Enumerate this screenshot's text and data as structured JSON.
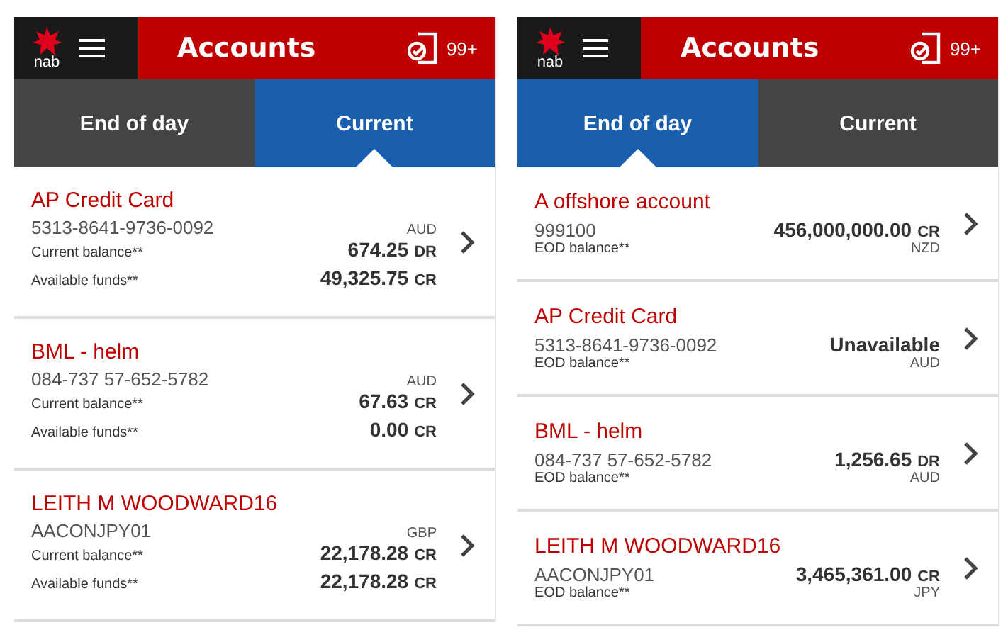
{
  "screens": [
    {
      "header": {
        "logo_text": "nab",
        "title": "Accounts",
        "badge": "99+"
      },
      "tabs": [
        {
          "label": "End of day",
          "selected": false
        },
        {
          "label": "Current",
          "selected": true
        }
      ],
      "accounts": [
        {
          "kind": "current",
          "name": "AP Credit Card",
          "number": "5313-8641-9736-0092",
          "currency": "AUD",
          "lines": [
            {
              "label": "Current balance**",
              "amount": "674.25",
              "type": "DR"
            },
            {
              "label": "Available funds**",
              "amount": "49,325.75",
              "type": "CR"
            }
          ]
        },
        {
          "kind": "current",
          "name": "BML - helm",
          "number": "084-737 57-652-5782",
          "currency": "AUD",
          "lines": [
            {
              "label": "Current balance**",
              "amount": "67.63",
              "type": "CR"
            },
            {
              "label": "Available funds**",
              "amount": "0.00",
              "type": "CR"
            }
          ]
        },
        {
          "kind": "current",
          "name": "LEITH M WOODWARD16",
          "number": "AACONJPY01",
          "currency": "GBP",
          "lines": [
            {
              "label": "Current balance**",
              "amount": "22,178.28",
              "type": "CR"
            },
            {
              "label": "Available funds**",
              "amount": "22,178.28",
              "type": "CR"
            }
          ]
        }
      ]
    },
    {
      "header": {
        "logo_text": "nab",
        "title": "Accounts",
        "badge": "99+"
      },
      "tabs": [
        {
          "label": "End of day",
          "selected": true
        },
        {
          "label": "Current",
          "selected": false
        }
      ],
      "accounts": [
        {
          "kind": "eod",
          "name": "A offshore account",
          "number": "999100",
          "label": "EOD balance**",
          "amount": "456,000,000.00",
          "type": "CR",
          "currency": "NZD"
        },
        {
          "kind": "eod",
          "name": "AP Credit Card",
          "number": "5313-8641-9736-0092",
          "label": "EOD balance**",
          "amount": "Unavailable",
          "currency": "AUD"
        },
        {
          "kind": "eod",
          "name": "BML - helm",
          "number": "084-737 57-652-5782",
          "label": "EOD balance**",
          "amount": "1,256.65",
          "type": "DR",
          "currency": "AUD"
        },
        {
          "kind": "eod",
          "name": "LEITH M WOODWARD16",
          "number": "AACONJPY01",
          "label": "EOD balance**",
          "amount": "3,465,361.00",
          "type": "CR",
          "currency": "JPY"
        }
      ]
    }
  ]
}
